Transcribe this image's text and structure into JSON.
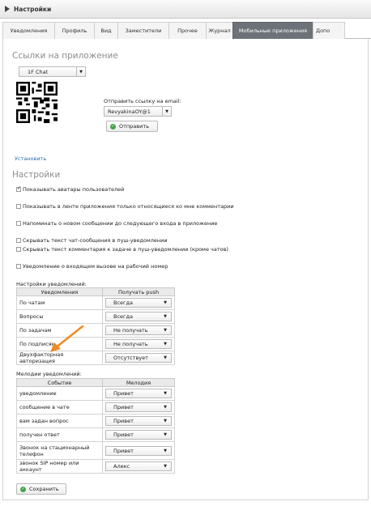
{
  "app": {
    "title": "Настройки"
  },
  "tabs": [
    {
      "label": "Уведомления"
    },
    {
      "label": "Профиль"
    },
    {
      "label": "Вид"
    },
    {
      "label": "Заместители"
    },
    {
      "label": "Прочее"
    },
    {
      "label": "Журнал"
    },
    {
      "label": "Мобильные приложения"
    },
    {
      "label": "Допо"
    }
  ],
  "links_section": {
    "heading": "Ссылки на приложение",
    "app_select": "1F Chat",
    "email_label": "Отправить ссылку на email:",
    "email_select": "RevyakinaOY@1",
    "send_label": "Отправить",
    "install_link": "Установить"
  },
  "settings": {
    "heading": "Настройки",
    "checkboxes": [
      {
        "label": "Показывать аватары пользователей",
        "checked": true
      },
      {
        "label": "Показывать в ленте приложения только относящиеся ко мне комментарии",
        "checked": false
      },
      {
        "label": "Напоминать о новом сообщении до следующего входа в приложение",
        "checked": false
      },
      {
        "label": "Скрывать текст чат-сообщения в пуш-уведомлении",
        "checked": false
      },
      {
        "label": "Скрывать текст комментария к задаче в пуш-уведомлении (кроме чатов)",
        "checked": false
      },
      {
        "label": "Уведомление о входящем вызове на рабочий номер",
        "checked": false
      }
    ]
  },
  "notifications": {
    "title": "Настройки уведомлений:",
    "headers": [
      "Уведомления",
      "Получать push"
    ],
    "rows": [
      {
        "label": "По чатам",
        "value": "Всегда"
      },
      {
        "label": "Вопросы",
        "value": "Всегда"
      },
      {
        "label": "По задачам",
        "value": "Не получать"
      },
      {
        "label": "По подписям",
        "value": "Не получать"
      },
      {
        "label": "Двухфакторная авторизация",
        "value": "Отсутствует"
      }
    ]
  },
  "melodies": {
    "title": "Мелодии уведомлений:",
    "headers": [
      "Событие",
      "Мелодия"
    ],
    "rows": [
      {
        "label": "уведомление",
        "value": "Привет"
      },
      {
        "label": "сообщение в чате",
        "value": "Привет"
      },
      {
        "label": "вам задан вопрос",
        "value": "Привет"
      },
      {
        "label": "получен ответ",
        "value": "Привет"
      },
      {
        "label": "Звонок на стационарный телефон",
        "value": "Привет"
      },
      {
        "label": "звонок SIP номер или аккаунт",
        "value": "Алекс"
      }
    ]
  },
  "footer": {
    "save_label": "Сохранить"
  },
  "colors": {
    "active_tab": "#6c7278",
    "link": "#2a6db0",
    "ok_icon": "#47a447",
    "arrow": "#f08a24"
  },
  "icons": {
    "play": "play-icon",
    "dropdown": "chevron-down-icon",
    "ok": "check-circle-icon",
    "qr": "qr-code-icon",
    "annotation": "arrow-icon"
  }
}
